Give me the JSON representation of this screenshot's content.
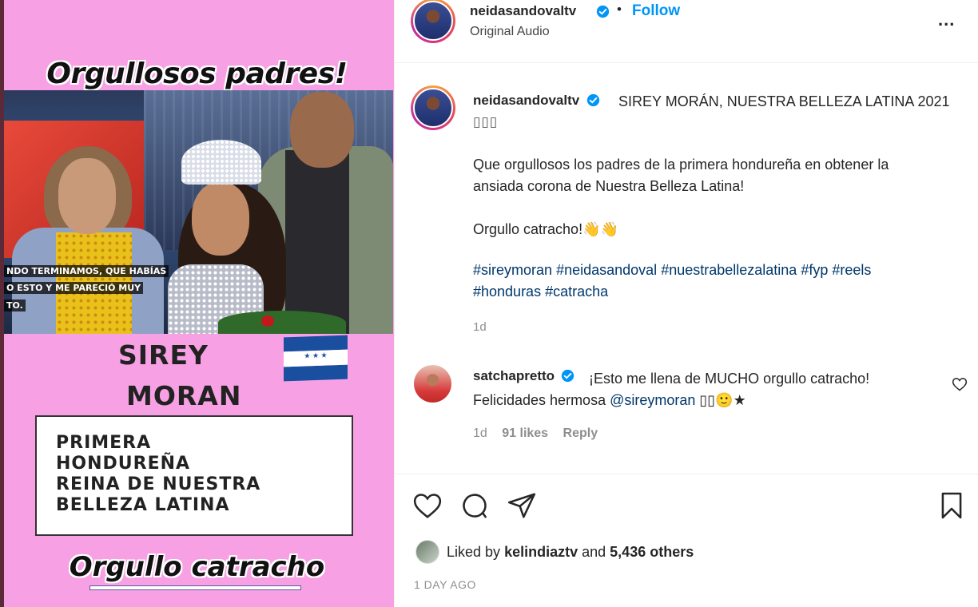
{
  "media": {
    "title_top": "Orgullosos padres!",
    "captions": [
      "NDO TERMINAMOS, QUE HABÍAS",
      "O ESTO Y ME PARECIÓ MUY",
      "TO."
    ],
    "name_line1": "SIREY",
    "name_line2": "MORAN",
    "flag_stars": "★ ★ ★",
    "box_lines": [
      "PRIMERA",
      "HONDUREÑA",
      "REINA DE NUESTRA",
      "BELLEZA LATINA"
    ],
    "title_bottom": "Orgullo catracho"
  },
  "header": {
    "username": "neidasandovaltv",
    "separator": "•",
    "follow_label": "Follow",
    "audio_label": "Original Audio",
    "more_label": "..."
  },
  "caption": {
    "username": "neidasandovaltv",
    "title": "SIREY MORÁN, NUESTRA BELLEZA LATINA 2021",
    "emoji": "▯▯▯",
    "paragraph1_line1": "Que orgullosos los padres de la primera hondureña en obtener la",
    "paragraph1_line2": "ansiada corona de Nuestra Belleza Latina!",
    "paragraph2": "Orgullo catracho!👋👋",
    "hashtags_line1": [
      "#sireymoran",
      "#neidasandoval",
      "#nuestrabellezalatina",
      "#fyp",
      "#reels"
    ],
    "hashtags_line2": [
      "#honduras",
      "#catracha"
    ],
    "age": "1d"
  },
  "comment": {
    "username": "satchapretto",
    "text_part1": "¡Esto me llena de MUCHO orgullo catracho!",
    "text_part2": "Felicidades hermosa",
    "mention": "@sireymoran",
    "text_emoji": "▯▯🙂★",
    "age": "1d",
    "likes": "91 likes",
    "reply_label": "Reply"
  },
  "footer": {
    "liked_prefix": "Liked by",
    "liked_user": "kelindiaztv",
    "liked_and": "and",
    "liked_others": "5,436 others",
    "timestamp": "1 DAY AGO"
  },
  "colors": {
    "media_bg": "#f7a1e4",
    "link_blue": "#0095f6",
    "hashtag_blue": "#00376b",
    "muted": "#8e8e8e"
  }
}
